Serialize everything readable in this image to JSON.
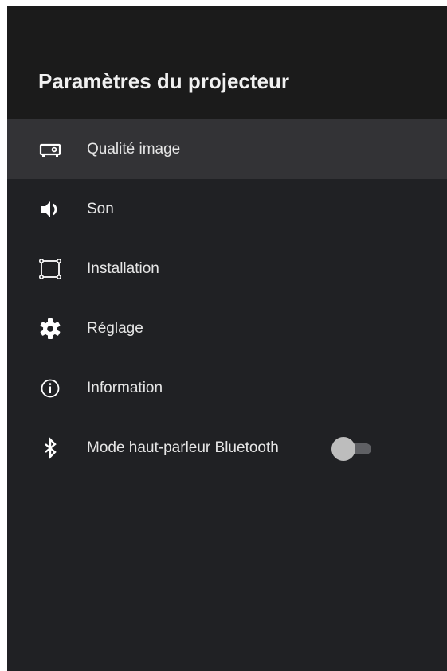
{
  "header": {
    "title": "Paramètres du projecteur"
  },
  "menu": {
    "items": [
      {
        "label": "Qualité image",
        "icon": "projector-icon",
        "selected": true
      },
      {
        "label": "Son",
        "icon": "speaker-icon"
      },
      {
        "label": "Installation",
        "icon": "installation-frame-icon"
      },
      {
        "label": "Réglage",
        "icon": "gear-icon"
      },
      {
        "label": "Information",
        "icon": "info-icon"
      },
      {
        "label": "Mode haut-parleur Bluetooth",
        "icon": "bluetooth-icon",
        "toggle": {
          "on": false
        }
      }
    ]
  },
  "colors": {
    "background": "#202124",
    "header_background": "#1b1b1b",
    "selected_row": "#333336",
    "text": "#e6e6e6",
    "title_text": "#f1f1f1",
    "toggle_track": "#5f6064",
    "toggle_thumb": "#bdbdbd"
  }
}
